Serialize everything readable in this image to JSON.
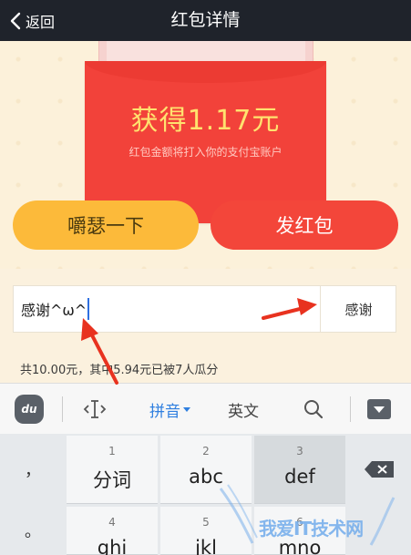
{
  "nav": {
    "back_label": "返回",
    "title": "红包详情"
  },
  "envelope": {
    "amount_text": "获得1.17元",
    "note": "红包金额将打入你的支付宝账户"
  },
  "actions": {
    "shake_label": "嚼瑟一下",
    "send_label": "发红包"
  },
  "thanks": {
    "input_value": "感谢^ω^",
    "button_label": "感谢"
  },
  "summary_text": "共10.00元，其中5.94元已被7人瓜分",
  "ime": {
    "logo": "du",
    "pinyin_label": "拼音",
    "english_label": "英文"
  },
  "keyboard": {
    "row1": [
      {
        "num": "1",
        "letters": "分词"
      },
      {
        "num": "2",
        "letters": "abc"
      },
      {
        "num": "3",
        "letters": "def"
      }
    ],
    "row2": [
      {
        "num": "4",
        "letters": "ghi"
      },
      {
        "num": "5",
        "letters": "jkl"
      },
      {
        "num": "6",
        "letters": "mno"
      }
    ],
    "punct1": "，",
    "punct2": "。"
  },
  "watermark": "我爱IT技术网",
  "colors": {
    "navbar": "#1f232b",
    "envelope": "#f2423a",
    "amount": "#ffe26f",
    "shake_button": "#fcba3a",
    "send_button": "#f3463a",
    "annotation_arrow": "#e8321f",
    "ime_accent": "#2f7fe0"
  },
  "icons": [
    "chevron-left-icon",
    "text-cursor-icon",
    "search-icon",
    "collapse-keyboard-icon",
    "backspace-icon"
  ]
}
